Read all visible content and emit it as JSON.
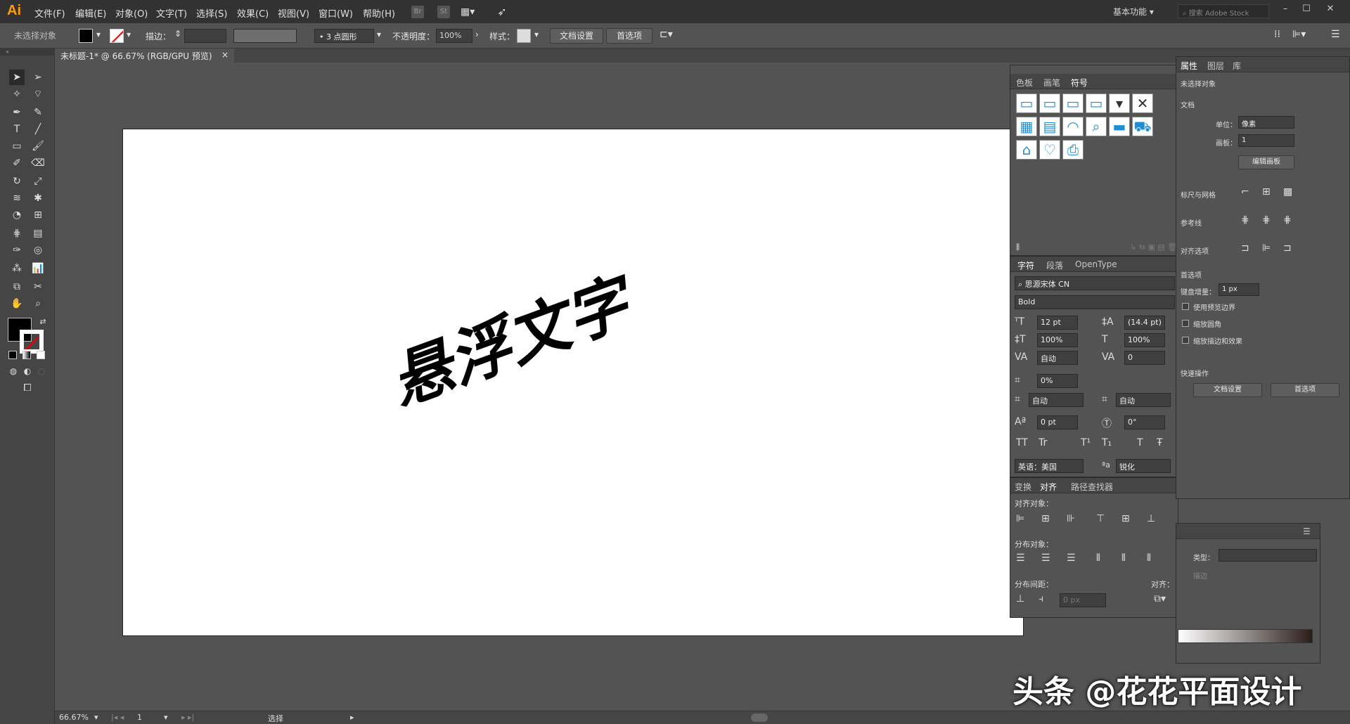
{
  "app": {
    "logo": "Ai"
  },
  "menu": [
    "文件(F)",
    "编辑(E)",
    "对象(O)",
    "文字(T)",
    "选择(S)",
    "效果(C)",
    "视图(V)",
    "窗口(W)",
    "帮助(H)"
  ],
  "menubar_icons": {
    "br": "Br",
    "st": "St"
  },
  "workspace": "基本功能",
  "stock_search": {
    "placeholder": "搜索 Adobe Stock"
  },
  "control": {
    "selection": "未选择对象",
    "stroke_label": "描边：",
    "brush": "3 点圆形",
    "opacity_label": "不透明度：",
    "opacity": "100%",
    "style_label": "样式：",
    "doc_setup": "文档设置",
    "prefs": "首选项"
  },
  "doc_tab": {
    "title": "未标题-1* @ 66.67% (RGB/GPU 预览)"
  },
  "artwork_text": "悬浮文字",
  "status": {
    "zoom": "66.67%",
    "artboard": "1",
    "tool": "选择"
  },
  "watermark": "头条 @花花平面设计",
  "symbols_panel": {
    "tabs": [
      "色板",
      "画笔",
      "符号"
    ]
  },
  "character_panel": {
    "tabs": [
      "字符",
      "段落",
      "OpenType"
    ],
    "font": "思源宋体 CN",
    "style": "Bold",
    "size": "12 pt",
    "leading": "(14.4 pt)",
    "hscale": "100%",
    "vscale": "100%",
    "kerning": "自动",
    "tracking": "0",
    "tsume": "0%",
    "aki_left": "自动",
    "aki_right": "自动",
    "baseline": "0 pt",
    "rotation": "0°",
    "language": "英语：美国",
    "aa_label": "a",
    "aa": "锐化",
    "tt_buttons": [
      "TT",
      "Tr",
      "T¹",
      "T₁",
      "T",
      "Ŧ"
    ]
  },
  "align_panel": {
    "tabs": [
      "变换",
      "对齐",
      "路径查找器"
    ],
    "align_objects": "对齐对象：",
    "distribute_objects": "分布对象：",
    "distribute_spacing": "分布间距：",
    "align_to": "对齐：",
    "spacing_value": "0 px"
  },
  "properties_panel": {
    "tabs": [
      "属性",
      "图层",
      "库"
    ],
    "no_selection": "未选择对象",
    "document": "文档",
    "units_label": "单位：",
    "units": "像素",
    "artboard_label": "画板：",
    "artboard": "1",
    "edit_artboard": "编辑画板",
    "rulers_grid": "标尺与网格",
    "guides": "参考线",
    "snap": "对齐选项",
    "preferences": "首选项",
    "key_increment_label": "键盘增量：",
    "key_increment": "1 px",
    "preview_bounds": "使用预览边界",
    "scale_corners": "缩放圆角",
    "scale_strokes": "缩放描边和效果",
    "quick_actions": "快速操作",
    "doc_setup": "文档设置",
    "prefs": "首选项"
  },
  "gradient_panel": {
    "type_label": "类型：",
    "stroke_label": "描边"
  }
}
